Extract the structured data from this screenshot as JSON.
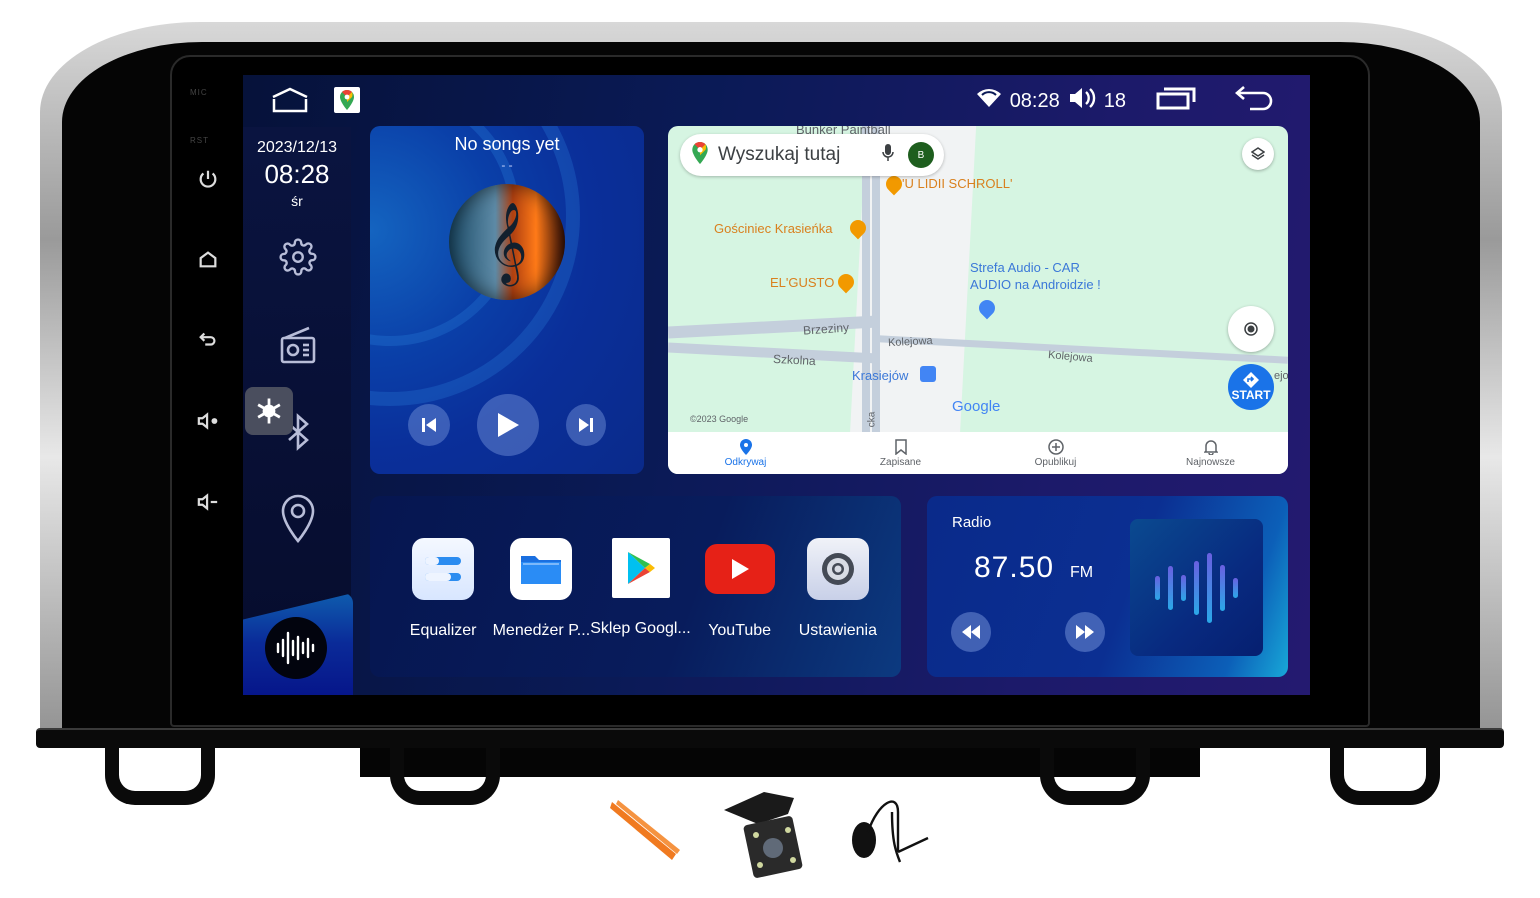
{
  "hardware": {
    "labels": [
      "MIC",
      "RST"
    ],
    "buttons": [
      "power-icon",
      "home-icon",
      "back-icon",
      "volume-up-icon",
      "volume-down-icon"
    ]
  },
  "statusbar": {
    "left_icons": [
      "home-outline-icon",
      "google-maps-icon"
    ],
    "time": "08:28",
    "volume": "18",
    "icons": [
      "wifi-icon",
      "volume-icon",
      "recent-apps-icon",
      "back-icon"
    ]
  },
  "sidebar": {
    "date": "2023/12/13",
    "time": "08:28",
    "day": "śr",
    "icons": [
      "settings-icon",
      "radio-icon",
      "bluetooth-icon",
      "location-icon"
    ],
    "overlay_icon": "snowflake-icon",
    "voice_icon": "voice-assistant-icon"
  },
  "music": {
    "title": "No songs yet",
    "subtitle": "- -",
    "controls": [
      "previous",
      "play",
      "next"
    ]
  },
  "map": {
    "search_placeholder": "Wyszukaj tutaj",
    "avatar_letter": "B",
    "labels": {
      "bunker": "Bunker Paintball",
      "ulidii": "'U LIDII SCHROLL'",
      "gosciniec": "Gościniec Krasieńka",
      "elgusto": "EL'GUSTO",
      "strefa_line1": "Strefa Audio - CAR",
      "strefa_line2": "AUDIO na Androidzie !",
      "brzeziny": "Brzeziny",
      "szkolna": "Szkolna",
      "kolejowa1": "Kolejowa",
      "kolejowa2": "Kolejowa",
      "krasiejow": "Krasiejów",
      "google": "Google",
      "copyright": "©2023 Google",
      "side_street": "cka",
      "kolejo": "ejo"
    },
    "start_label": "START",
    "nav": [
      {
        "label": "Odkrywaj",
        "active": true
      },
      {
        "label": "Zapisane",
        "active": false
      },
      {
        "label": "Opublikuj",
        "active": false
      },
      {
        "label": "Najnowsze",
        "active": false
      }
    ]
  },
  "apps": [
    {
      "label": "Equalizer"
    },
    {
      "label": "Menedżer P..."
    },
    {
      "label": "Sklep Googl..."
    },
    {
      "label": "YouTube"
    },
    {
      "label": "Ustawienia"
    }
  ],
  "radio": {
    "title": "Radio",
    "frequency": "87.50",
    "band": "FM"
  },
  "accessories": [
    "pry-tools",
    "rear-camera",
    "gps-antenna"
  ],
  "colors": {
    "accent_blue": "#1a73e8",
    "youtube_red": "#e62117",
    "poi_orange": "#d9801e",
    "map_green": "#d6f5e2"
  }
}
